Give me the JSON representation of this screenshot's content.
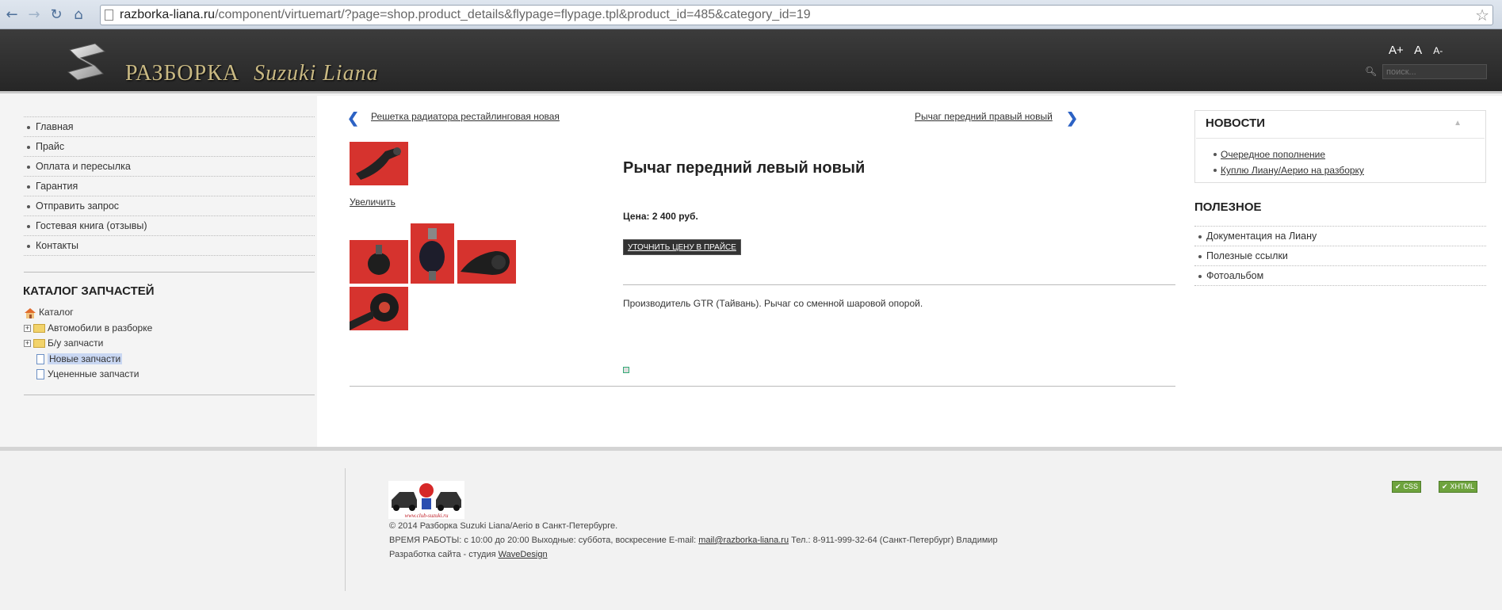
{
  "browser": {
    "url_host": "razborka-liana.ru",
    "url_path": "/component/virtuemart/?page=shop.product_details&flypage=flypage.tpl&product_id=485&category_id=19"
  },
  "header": {
    "logo_title": "РАЗБОРКА",
    "logo_subtitle": "Suzuki Liana",
    "font_larger": "A+",
    "font_normal": "A",
    "font_smaller": "A-",
    "search_placeholder": "поиск..."
  },
  "left_menu": [
    {
      "label": "Главная"
    },
    {
      "label": "Прайс"
    },
    {
      "label": "Оплата и пересылка"
    },
    {
      "label": "Гарантия"
    },
    {
      "label": "Отправить запрос"
    },
    {
      "label": "Гостевая книга (отзывы)"
    },
    {
      "label": "Контакты"
    }
  ],
  "catalog": {
    "title": "КАТАЛОГ ЗАПЧАСТЕЙ",
    "root": "Каталог",
    "items": [
      {
        "label": "Автомобили в разборке"
      },
      {
        "label": "Б/у запчасти"
      },
      {
        "label": "Новые запчасти"
      },
      {
        "label": "Уцененные запчасти"
      }
    ]
  },
  "product_nav": {
    "prev_label": "Решетка радиатора рестайлинговая новая",
    "next_label": "Рычаг передний правый новый"
  },
  "product": {
    "enlarge_label": "Увеличить",
    "title": "Рычаг передний левый новый",
    "price": "Цена: 2 400 руб.",
    "price_button": "УТОЧНИТЬ ЦЕНУ В ПРАЙСЕ",
    "description": "Производитель GTR (Тайвань). Рычаг со сменной шаровой опорой."
  },
  "news": {
    "title": "НОВОСТИ",
    "items": [
      {
        "label": "Очередное пополнение"
      },
      {
        "label": "Куплю Лиану/Аерио на разборку"
      }
    ]
  },
  "useful": {
    "title": "ПОЛЕЗНОЕ",
    "items": [
      {
        "label": "Документация на Лиану"
      },
      {
        "label": "Полезные ссылки"
      },
      {
        "label": "Фотоальбом"
      }
    ]
  },
  "footer": {
    "logo_caption": "www.club-suzuki.ru",
    "copyright": "© 2014 Разборка Suzuki Liana/Aerio в Санкт-Петербурге.",
    "hours_prefix": "ВРЕМЯ РАБОТЫ: с 10:00 до 20:00 Выходные: суббота, воскресение E-mail: ",
    "email": "mail@razborka-liana.ru",
    "hours_suffix": " Тел.: 8-911-999-32-64 (Санкт-Петербург) Владимир",
    "dev_prefix": "Разработка сайта - студия ",
    "dev_link": "WaveDesign",
    "badge_css": "CSS",
    "badge_xhtml": "XHTML"
  },
  "colors": {
    "header_bg": "#2b2b2b",
    "logo_gold": "#c9b983",
    "nav_arrow": "#2c62c4",
    "badge_green": "#6ea33d",
    "thumb_red": "#d6332e"
  }
}
